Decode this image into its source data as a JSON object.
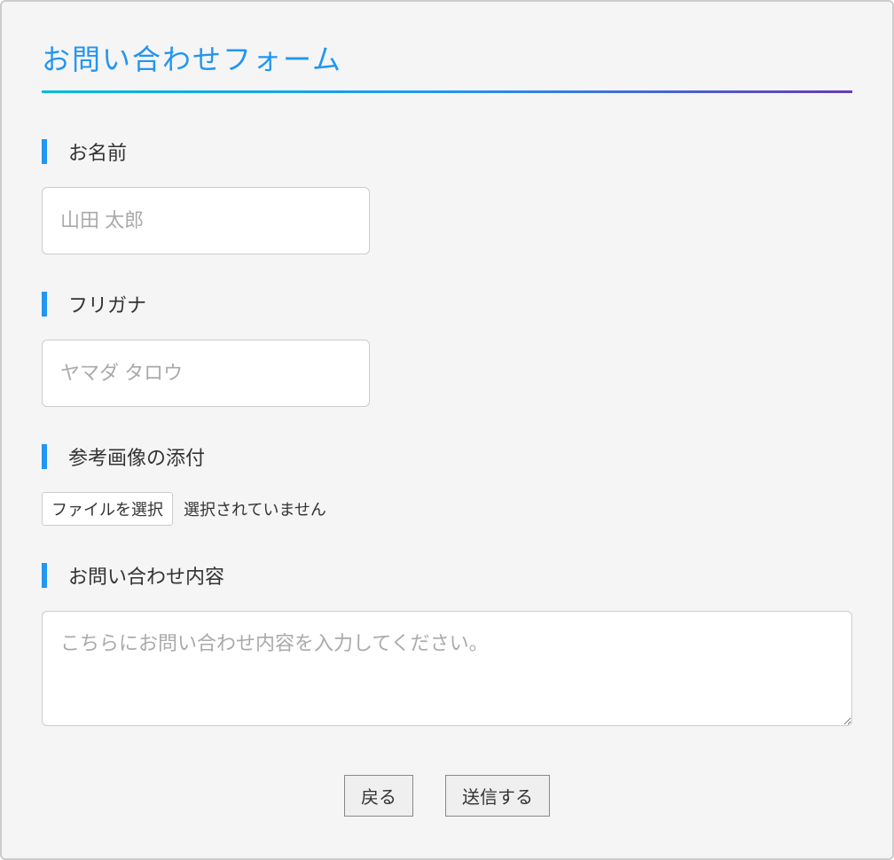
{
  "form": {
    "title": "お問い合わせフォーム",
    "fields": {
      "name": {
        "label": "お名前",
        "placeholder": "山田 太郎"
      },
      "furigana": {
        "label": "フリガナ",
        "placeholder": "ヤマダ タロウ"
      },
      "attachment": {
        "label": "参考画像の添付",
        "button": "ファイルを選択",
        "status": "選択されていません"
      },
      "content": {
        "label": "お問い合わせ内容",
        "placeholder": "こちらにお問い合わせ内容を入力してください。"
      }
    },
    "buttons": {
      "back": "戻る",
      "submit": "送信する"
    }
  }
}
